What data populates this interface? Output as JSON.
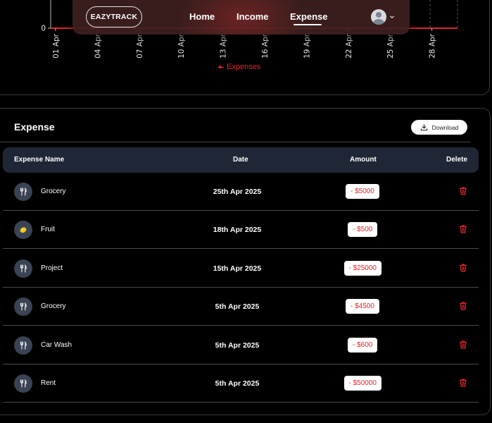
{
  "navbar": {
    "brand": "EAZYTRACK",
    "links": [
      {
        "label": "Home",
        "active": false
      },
      {
        "label": "Income",
        "active": false
      },
      {
        "label": "Expense",
        "active": true
      }
    ],
    "avatar_icon": "user-avatar-icon",
    "menu_icon": "chevron-down-icon"
  },
  "chart_data": {
    "type": "line",
    "x_ticks": [
      "01 Apr",
      "04 Apr",
      "07 Apr",
      "10 Apr",
      "13 Apr",
      "16 Apr",
      "19 Apr",
      "22 Apr",
      "25 Apr",
      "28 Apr"
    ],
    "y_ticks": [
      "0"
    ],
    "series": [
      {
        "name": "Expenses",
        "color": "#e0262b"
      }
    ],
    "legend": "bottom-center"
  },
  "expense_section": {
    "title": "Expense",
    "download_label": "Download",
    "download_icon": "download-icon",
    "columns": {
      "name": "Expense Name",
      "date": "Date",
      "amount": "Amount",
      "delete": "Delete"
    },
    "rows": [
      {
        "name": "Grocery",
        "icon": "fork-knife-icon",
        "date": "25th Apr 2025",
        "amount": "- $5000"
      },
      {
        "name": "Fruit",
        "icon": "lemon-icon",
        "date": "18th Apr 2025",
        "amount": "- $500"
      },
      {
        "name": "Project",
        "icon": "fork-knife-icon",
        "date": "15th Apr 2025",
        "amount": "- $25000"
      },
      {
        "name": "Grocery",
        "icon": "fork-knife-icon",
        "date": "5th Apr 2025",
        "amount": "- $4500"
      },
      {
        "name": "Car Wash",
        "icon": "fork-knife-icon",
        "date": "5th Apr 2025",
        "amount": "- $600"
      },
      {
        "name": "Rent",
        "icon": "fork-knife-icon",
        "date": "5th Apr 2025",
        "amount": "- $50000"
      }
    ],
    "delete_icon": "trash-icon",
    "colors": {
      "accent": "#e0262b",
      "header_bg": "#1f2736",
      "icon_bg": "#3a4353"
    }
  }
}
